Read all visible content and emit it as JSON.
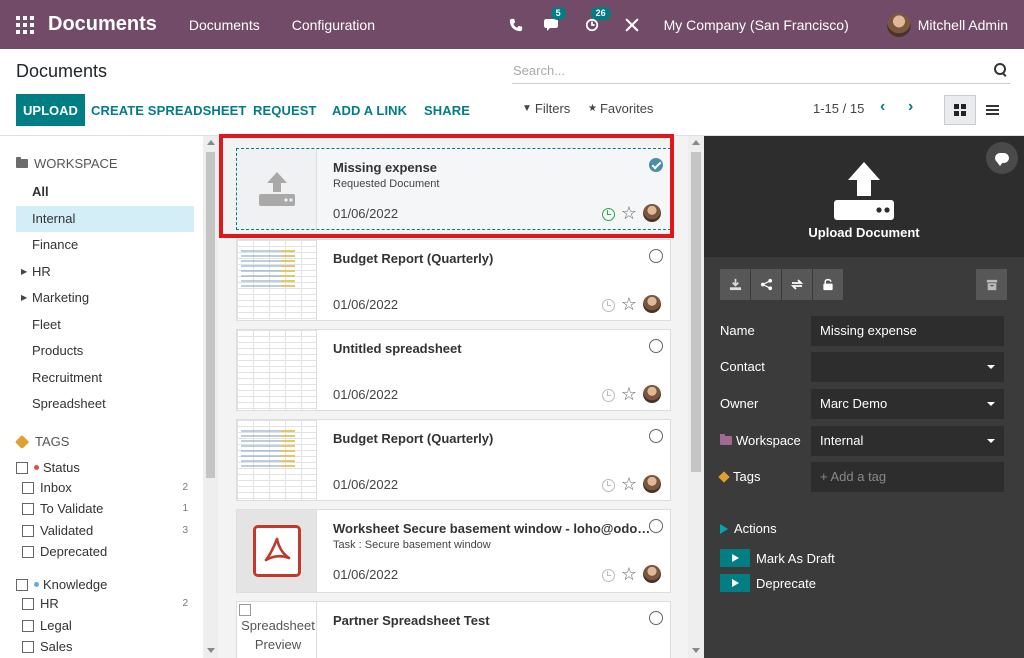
{
  "navbar": {
    "brand": "Documents",
    "menu": [
      "Documents",
      "Configuration"
    ],
    "messages_badge": "5",
    "activities_badge": "26",
    "company": "My Company (San Francisco)",
    "user": "Mitchell Admin"
  },
  "control_panel": {
    "title": "Documents",
    "search_placeholder": "Search...",
    "buttons": {
      "upload": "UPLOAD",
      "create_spreadsheet": "CREATE SPREADSHEET",
      "request": "REQUEST",
      "add_link": "ADD A LINK",
      "share": "SHARE"
    },
    "filters": "Filters",
    "favorites": "Favorites",
    "pager": "1-15 / 15"
  },
  "sidebar": {
    "workspace_header": "WORKSPACE",
    "workspaces": [
      {
        "label": "All",
        "bold": true
      },
      {
        "label": "Internal",
        "active": true
      },
      {
        "label": "Finance"
      },
      {
        "label": "HR",
        "expandable": true
      },
      {
        "label": "Marketing",
        "expandable": true
      },
      {
        "label": "Fleet"
      },
      {
        "label": "Products"
      },
      {
        "label": "Recruitment"
      },
      {
        "label": "Spreadsheet"
      }
    ],
    "tags_header": "TAGS",
    "tag_groups": [
      {
        "label": "Status",
        "color": "#e74c3c",
        "items": [
          {
            "label": "Inbox",
            "count": "2"
          },
          {
            "label": "To Validate",
            "count": "1"
          },
          {
            "label": "Validated",
            "count": "3"
          },
          {
            "label": "Deprecated",
            "count": ""
          }
        ]
      },
      {
        "label": "Knowledge",
        "color": "#5dade2",
        "items": [
          {
            "label": "HR",
            "count": "2"
          },
          {
            "label": "Legal",
            "count": ""
          },
          {
            "label": "Sales",
            "count": ""
          }
        ]
      }
    ]
  },
  "cards": [
    {
      "title": "Missing expense",
      "subtitle": "Requested Document",
      "date": "01/06/2022",
      "thumb": "upload",
      "selected": true
    },
    {
      "title": "Budget Report (Quarterly)",
      "subtitle": "",
      "date": "01/06/2022",
      "thumb": "sheet",
      "selected": false
    },
    {
      "title": "Untitled spreadsheet",
      "subtitle": "",
      "date": "01/06/2022",
      "thumb": "blank-sheet",
      "selected": false
    },
    {
      "title": "Budget Report (Quarterly)",
      "subtitle": "",
      "date": "01/06/2022",
      "thumb": "sheet",
      "selected": false
    },
    {
      "title": "Worksheet Secure basement window - loho@odoo.c...",
      "subtitle": "Task : Secure basement window",
      "date": "01/06/2022",
      "thumb": "pdf",
      "selected": false
    },
    {
      "title": "Partner Spreadsheet Test",
      "subtitle": "",
      "date": "",
      "thumb": "broken",
      "thumb_alt": "Spreadsheet Preview",
      "selected": false
    }
  ],
  "inspector": {
    "upload_label": "Upload Document",
    "fields": {
      "name_label": "Name",
      "name_value": "Missing expense",
      "contact_label": "Contact",
      "contact_value": "",
      "owner_label": "Owner",
      "owner_value": "Marc Demo",
      "workspace_label": "Workspace",
      "workspace_value": "Internal",
      "tags_label": "Tags",
      "tags_placeholder": "+ Add a tag"
    },
    "actions_header": "Actions",
    "actions": [
      "Mark As Draft",
      "Deprecate"
    ]
  },
  "colors": {
    "brand": "#714b67",
    "accent": "#017e84",
    "highlight": "#e0181c"
  }
}
